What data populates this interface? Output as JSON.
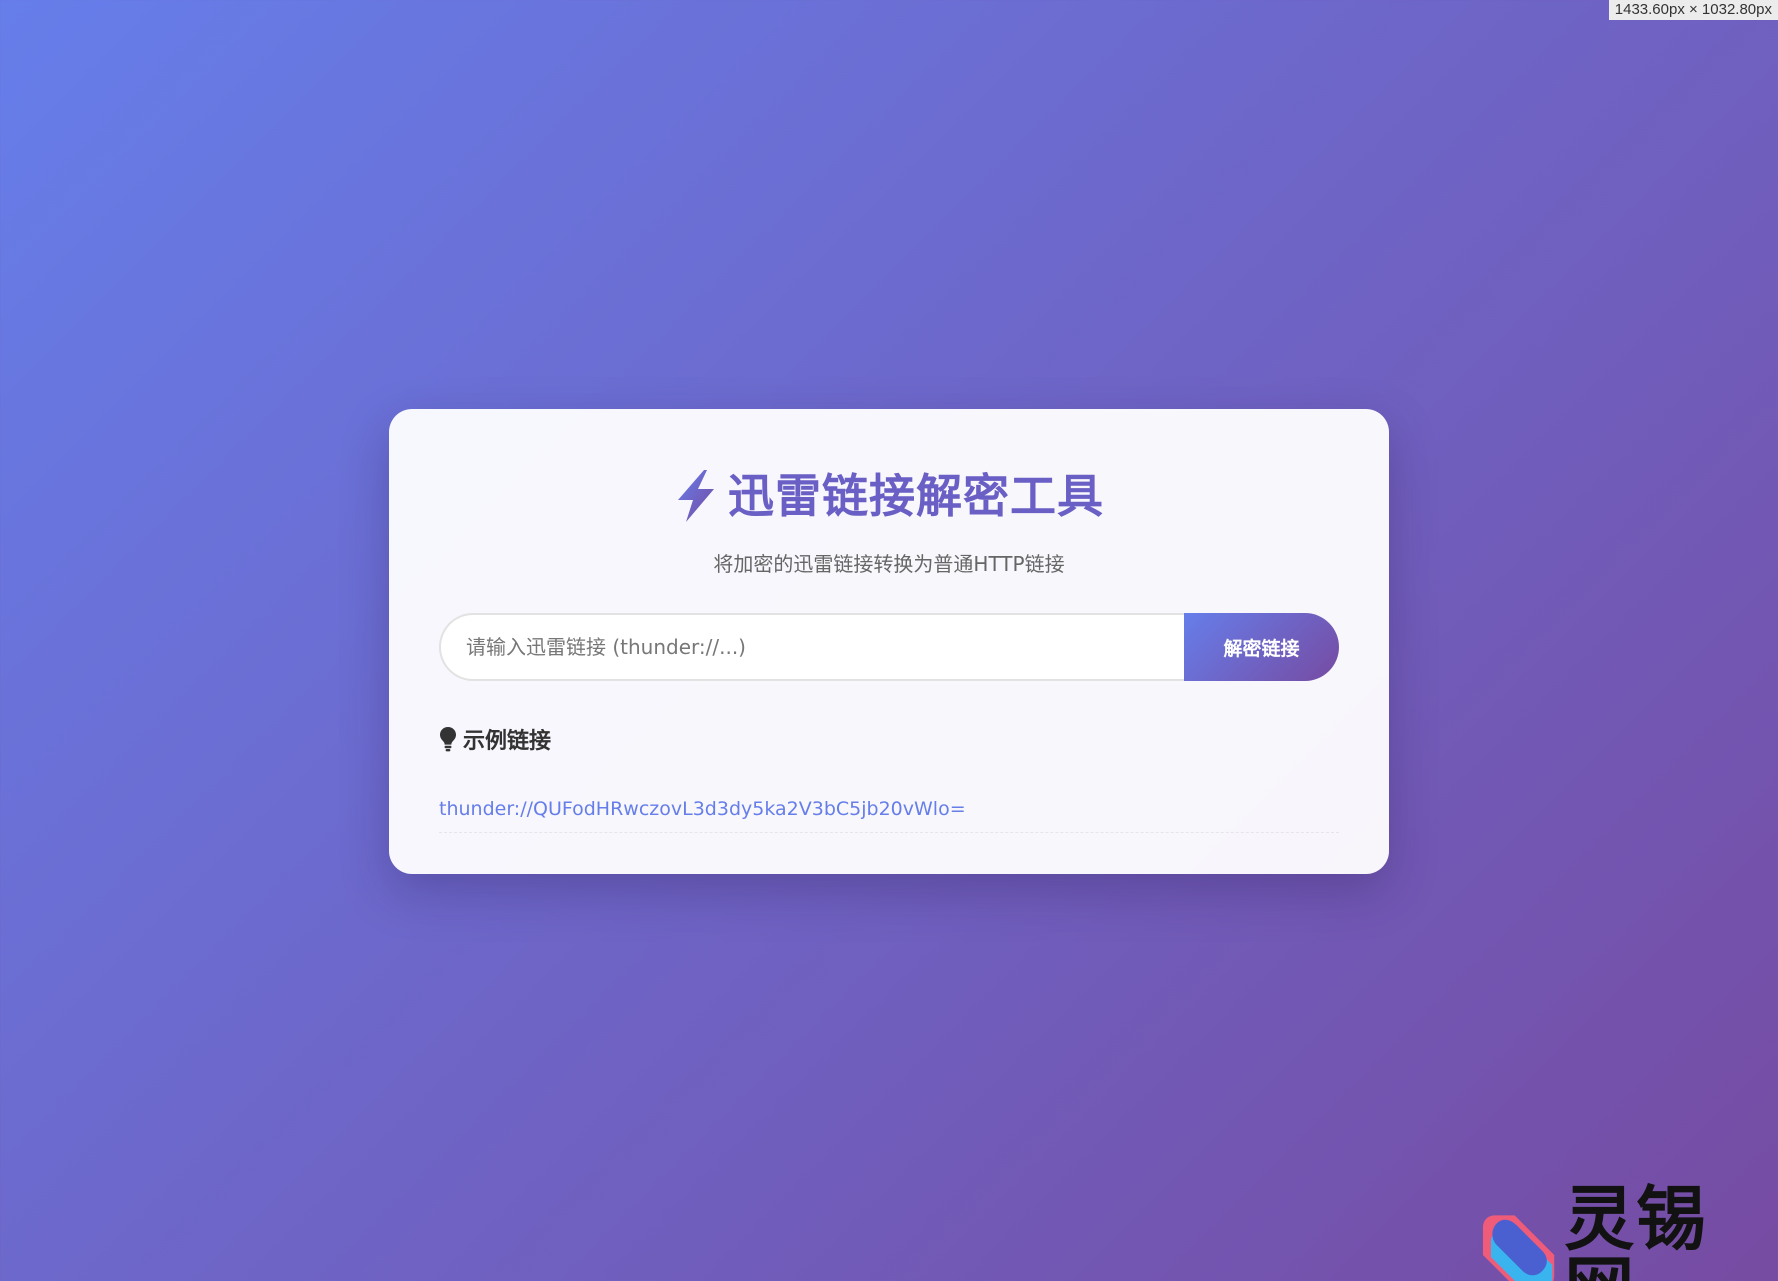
{
  "viewport_badge": "1433.60px × 1032.80px",
  "header": {
    "icon": "lightning-bolt-icon",
    "title": "迅雷链接解密工具",
    "subtitle": "将加密的迅雷链接转换为普通HTTP链接"
  },
  "form": {
    "input_value": "",
    "input_placeholder": "请输入迅雷链接 (thunder://...)",
    "decrypt_label": "解密链接"
  },
  "examples": {
    "icon": "lightbulb-icon",
    "title": "示例链接",
    "items": [
      "thunder://QUFodHRwczovL3d3dy5ka2V3bC5jb20vWlo="
    ]
  },
  "watermark": {
    "icon": "lingxi-logo-icon",
    "text": "灵锡网"
  },
  "colors": {
    "background_start": "#667eea",
    "background_end": "#764ba2",
    "accent": "#667eea",
    "title": "#6a5fc4"
  }
}
